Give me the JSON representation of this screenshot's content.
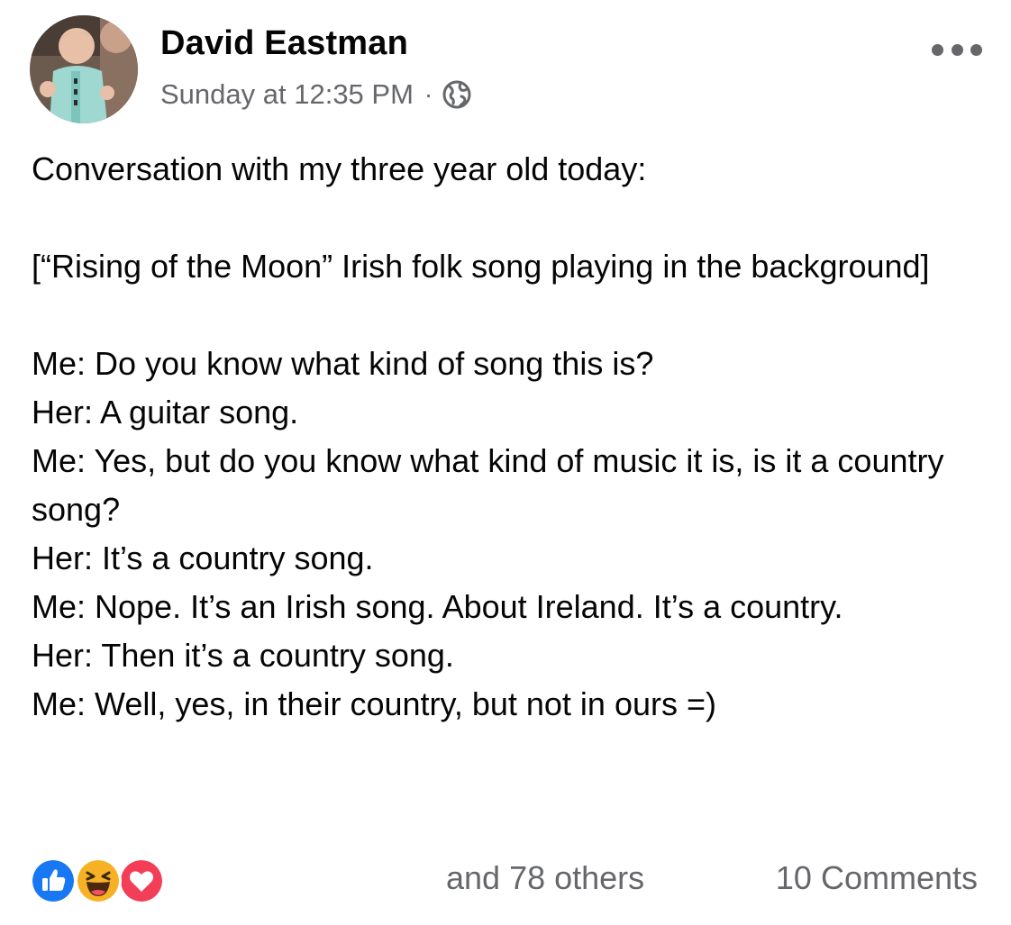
{
  "post": {
    "author": "David Eastman",
    "timestamp": "Sunday at 12:35 PM",
    "separator": "·",
    "audience_icon": "globe-icon",
    "menu_icon": "more-options-icon",
    "avatar_icon": "profile-photo",
    "lines": [
      "Conversation with my three year old today:",
      "",
      "[“Rising of the Moon” Irish folk song playing in the background]",
      "",
      "Me: Do you know what kind of song this is?",
      "Her: A guitar song.",
      "Me: Yes, but do you know what kind of music it is, is it a country song?",
      "Her: It’s a country song.",
      "Me: Nope. It’s an Irish song. About Ireland. It’s a country.",
      "Her: Then it’s a country song.",
      "Me: Well, yes, in their country, but not in ours =)"
    ]
  },
  "footer": {
    "reactions": [
      "like-icon",
      "haha-icon",
      "love-icon"
    ],
    "others_text": "and 78 others",
    "comments_text": "10 Comments"
  },
  "colors": {
    "text": "#050505",
    "secondary_text": "#65676b",
    "like_blue": "#1877f2",
    "haha_yellow": "#f7b125",
    "love_red": "#f33e58"
  }
}
